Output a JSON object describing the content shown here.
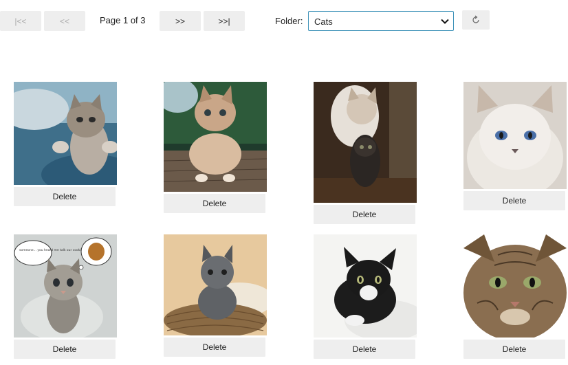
{
  "pager": {
    "first_label": "|<<",
    "prev_label": "<<",
    "page_info": "Page 1 of 3",
    "next_label": ">>",
    "last_label": ">>|"
  },
  "folder": {
    "label": "Folder:",
    "selected": "Cats"
  },
  "refresh_label": "↻",
  "photos": [
    {
      "alt": "kitten reaching up",
      "delete_label": "Delete"
    },
    {
      "alt": "kitten sitting on wooden deck",
      "delete_label": "Delete"
    },
    {
      "alt": "cat carrying kitten",
      "delete_label": "Delete"
    },
    {
      "alt": "white fluffy kitten with blue eyes",
      "delete_label": "Delete"
    },
    {
      "alt": "tabby kitten with thought bubble",
      "delete_label": "Delete",
      "caption": "someone... you heard me talk our cookie? ... ay blue"
    },
    {
      "alt": "grey kitten in basket",
      "delete_label": "Delete"
    },
    {
      "alt": "black and white kitten",
      "delete_label": "Delete"
    },
    {
      "alt": "tabby cat face",
      "delete_label": "Delete"
    }
  ],
  "colors": {
    "button_bg": "#eeeeee",
    "select_border": "#3f93b9"
  }
}
